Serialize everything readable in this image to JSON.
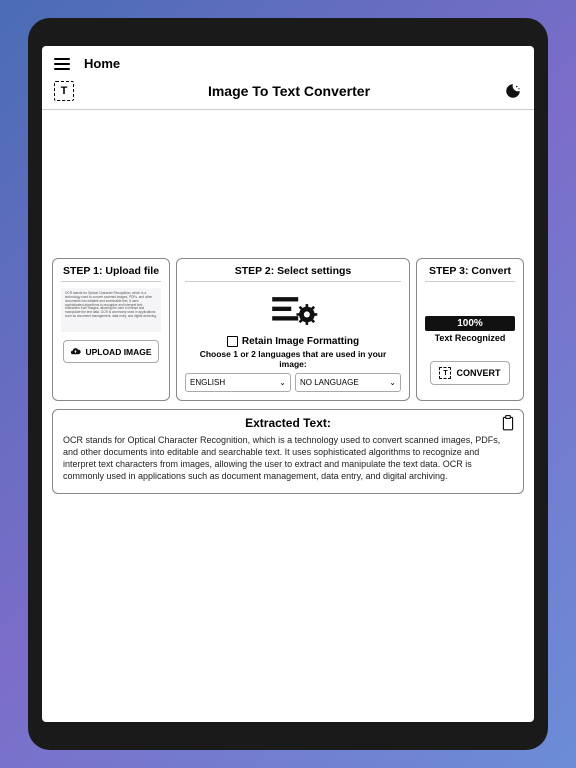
{
  "topbar": {
    "home": "Home"
  },
  "title": "Image To Text Converter",
  "steps": {
    "step1": {
      "title": "STEP 1: Upload file",
      "upload_label": "UPLOAD IMAGE",
      "preview_text": "OCR stands for Optical Character Recognition, which is a technology used to convert scanned images, PDFs, and other documents into editable and searchable text. It uses sophisticated algorithms to recognize and interpret text characters from images, allowing the user to extract and manipulate the text data. OCR is commonly used in applications such as document management, data entry, and digital archiving."
    },
    "step2": {
      "title": "STEP 2: Select settings",
      "retain_label": "Retain Image Formatting",
      "lang_hint": "Choose 1 or 2 languages that are used in your image:",
      "lang1": "ENGLISH",
      "lang2": "NO LANGUAGE"
    },
    "step3": {
      "title": "STEP 3: Convert",
      "progress": "100%",
      "recognized": "Text Recognized",
      "convert_label": "CONVERT"
    }
  },
  "extracted": {
    "title": "Extracted Text:",
    "body": "OCR stands for Optical Character Recognition, which is a technology used to convert scanned images, PDFs, and other documents into editable and searchable text. It uses sophisticated algorithms to recognize and interpret text characters from images, allowing the user to extract and manipulate the text data. OCR is commonly used in applications such as document management, data entry, and digital archiving."
  }
}
